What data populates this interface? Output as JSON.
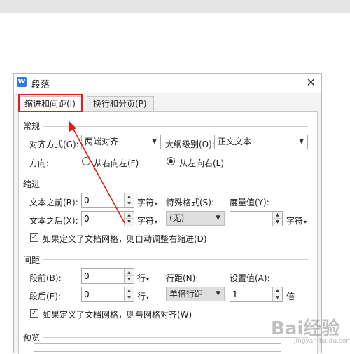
{
  "dialog": {
    "title": "段落",
    "close_glyph": "✕",
    "app_icon_glyph": "W"
  },
  "tabs": [
    {
      "label": "缩进和间距(I)",
      "active": true
    },
    {
      "label": "换行和分页(P)",
      "active": false
    }
  ],
  "general": {
    "section": "常规",
    "alignment_label": "对齐方式(G):",
    "alignment_value": "两端对齐",
    "outline_label": "大纲级别(O):",
    "outline_value": "正文文本",
    "direction_label": "方向:",
    "rtl_label": "从右向左(F)",
    "ltr_label": "从左向右(L)"
  },
  "indent": {
    "section": "缩进",
    "before_label": "文本之前(R):",
    "before_value": "0",
    "before_unit": "字符",
    "after_label": "文本之后(X):",
    "after_value": "0",
    "after_unit": "字符",
    "special_label": "特殊格式(S):",
    "special_value": "(无)",
    "measure_label": "度量值(Y):",
    "measure_value": "",
    "measure_unit": "字符",
    "auto_adjust_label": "如果定义了文档网格，则自动调整右缩进(D)"
  },
  "spacing": {
    "section": "间距",
    "before_label": "段前(B):",
    "before_value": "0",
    "before_unit": "行",
    "after_label": "段后(E):",
    "after_value": "0",
    "after_unit": "行",
    "line_label": "行距(N):",
    "line_value": "单倍行距",
    "setting_label": "设置值(A):",
    "setting_value": "1",
    "setting_unit": "倍",
    "snap_grid_label": "如果定义了文档网格，则与网格对齐(W)"
  },
  "preview": {
    "section": "预览"
  },
  "watermark": {
    "text": "Bai经验",
    "sub": "jingyan.baidu.com"
  },
  "colors": {
    "highlight": "#e01c1c",
    "app_icon": "#2f7ae5"
  }
}
